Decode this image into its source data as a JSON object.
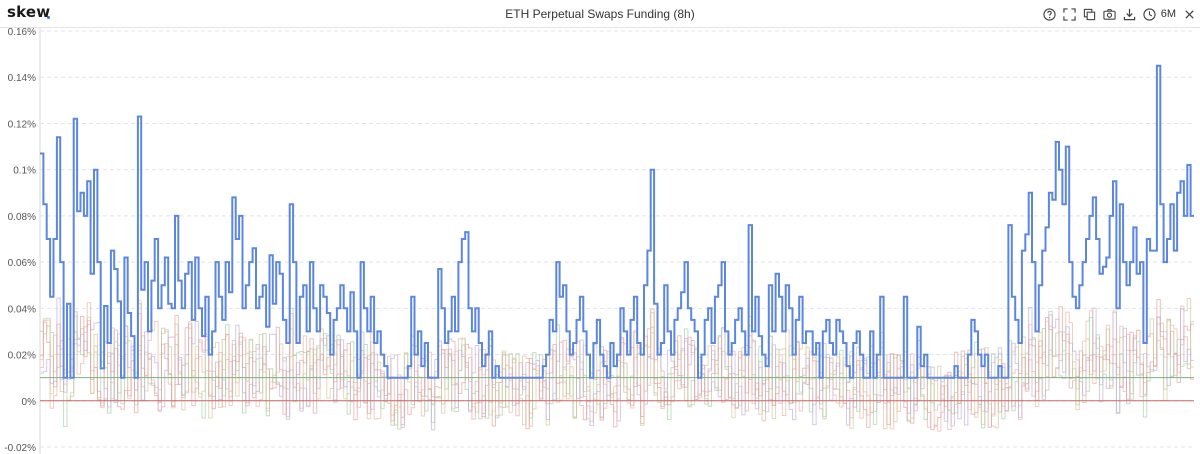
{
  "app": {
    "logo": "skew"
  },
  "header": {
    "title": "ETH Perpetual Swaps Funding (8h)",
    "range_label": "6M",
    "icons": [
      "help-icon",
      "fullscreen-icon",
      "copy-icon",
      "camera-icon",
      "download-icon",
      "clock-icon",
      "close-icon"
    ]
  },
  "colors": {
    "main_series": "#5b87e0",
    "zero_line": "#cc6666",
    "baseline": "#76b27a",
    "grid": "#e4e4e4"
  },
  "chart_data": {
    "type": "line",
    "step": true,
    "title": "ETH Perpetual Swaps Funding (8h)",
    "y_ticks": [
      "0.16%",
      "0.14%",
      "0.12%",
      "0.1%",
      "0.08%",
      "0.06%",
      "0.04%",
      "0.02%",
      "0%",
      "-0.02%"
    ],
    "y_tick_values": [
      0.16,
      0.14,
      0.12,
      0.1,
      0.08,
      0.06,
      0.04,
      0.02,
      0,
      -0.02
    ],
    "ylim": [
      -0.022,
      0.162
    ],
    "grid": true,
    "legend": "none",
    "series": [
      {
        "color": "#5b87e0",
        "values": [
          0.107,
          0.085,
          0.07,
          0.045,
          0.07,
          0.114,
          0.06,
          0.01,
          0.042,
          0.01,
          0.122,
          0.082,
          0.09,
          0.08,
          0.095,
          0.055,
          0.1,
          0.06,
          0.014,
          0.041,
          0.025,
          0.065,
          0.057,
          0.043,
          0.01,
          0.062,
          0.038,
          0.028,
          0.01,
          0.123,
          0.048,
          0.06,
          0.03,
          0.052,
          0.07,
          0.04,
          0.05,
          0.062,
          0.042,
          0.04,
          0.08,
          0.052,
          0.04,
          0.055,
          0.06,
          0.035,
          0.062,
          0.04,
          0.028,
          0.045,
          0.02,
          0.03,
          0.06,
          0.045,
          0.035,
          0.06,
          0.047,
          0.088,
          0.07,
          0.08,
          0.04,
          0.05,
          0.06,
          0.066,
          0.04,
          0.045,
          0.05,
          0.032,
          0.063,
          0.042,
          0.06,
          0.055,
          0.035,
          0.025,
          0.085,
          0.06,
          0.025,
          0.045,
          0.05,
          0.03,
          0.06,
          0.04,
          0.03,
          0.05,
          0.045,
          0.038,
          0.02,
          0.035,
          0.04,
          0.05,
          0.04,
          0.03,
          0.047,
          0.03,
          0.01,
          0.06,
          0.04,
          0.03,
          0.045,
          0.025,
          0.03,
          0.02,
          0.015,
          0.01,
          0.01,
          0.01,
          0.01,
          0.01,
          0.01,
          0.015,
          0.045,
          0.02,
          0.03,
          0.015,
          0.025,
          0.01,
          0.01,
          0.01,
          0.057,
          0.04,
          0.025,
          0.03,
          0.045,
          0.03,
          0.06,
          0.07,
          0.073,
          0.04,
          0.03,
          0.04,
          0.025,
          0.015,
          0.02,
          0.03,
          0.01,
          0.015,
          0.01,
          0.01,
          0.01,
          0.01,
          0.01,
          0.01,
          0.01,
          0.01,
          0.01,
          0.01,
          0.01,
          0.01,
          0.01,
          0.015,
          0.02,
          0.035,
          0.03,
          0.06,
          0.045,
          0.05,
          0.03,
          0.02,
          0.025,
          0.035,
          0.045,
          0.03,
          0.02,
          0.01,
          0.025,
          0.035,
          0.02,
          0.015,
          0.01,
          0.025,
          0.015,
          0.02,
          0.04,
          0.03,
          0.02,
          0.035,
          0.045,
          0.025,
          0.02,
          0.05,
          0.065,
          0.1,
          0.042,
          0.02,
          0.025,
          0.05,
          0.03,
          0.02,
          0.035,
          0.04,
          0.047,
          0.06,
          0.04,
          0.035,
          0.03,
          0.01,
          0.02,
          0.035,
          0.04,
          0.025,
          0.045,
          0.05,
          0.06,
          0.03,
          0.02,
          0.025,
          0.035,
          0.04,
          0.03,
          0.02,
          0.076,
          0.03,
          0.045,
          0.028,
          0.02,
          0.015,
          0.05,
          0.03,
          0.055,
          0.045,
          0.03,
          0.05,
          0.04,
          0.02,
          0.035,
          0.045,
          0.025,
          0.03,
          0.03,
          0.02,
          0.025,
          0.01,
          0.03,
          0.035,
          0.025,
          0.02,
          0.035,
          0.03,
          0.025,
          0.015,
          0.01,
          0.025,
          0.03,
          0.02,
          0.01,
          0.01,
          0.03,
          0.01,
          0.02,
          0.045,
          0.01,
          0.01,
          0.01,
          0.01,
          0.01,
          0.01,
          0.045,
          0.01,
          0.01,
          0.01,
          0.032,
          0.015,
          0.02,
          0.01,
          0.01,
          0.01,
          0.01,
          0.01,
          0.01,
          0.01,
          0.01,
          0.015,
          0.01,
          0.01,
          0.01,
          0.02,
          0.035,
          0.03,
          0.02,
          0.015,
          0.02,
          0.01,
          0.01,
          0.01,
          0.015,
          0.01,
          0.01,
          0.076,
          0.045,
          0.035,
          0.025,
          0.065,
          0.072,
          0.09,
          0.06,
          0.03,
          0.05,
          0.065,
          0.075,
          0.09,
          0.087,
          0.112,
          0.1,
          0.085,
          0.11,
          0.06,
          0.045,
          0.04,
          0.05,
          0.06,
          0.07,
          0.08,
          0.088,
          0.07,
          0.055,
          0.058,
          0.062,
          0.08,
          0.095,
          0.04,
          0.085,
          0.06,
          0.05,
          0.06,
          0.075,
          0.055,
          0.06,
          0.025,
          0.07,
          0.065,
          0.065,
          0.145,
          0.085,
          0.06,
          0.07,
          0.085,
          0.065,
          0.09,
          0.095,
          0.08,
          0.102,
          0.08
        ]
      }
    ],
    "baseline_value": 0.01,
    "zero_line_value": 0
  }
}
